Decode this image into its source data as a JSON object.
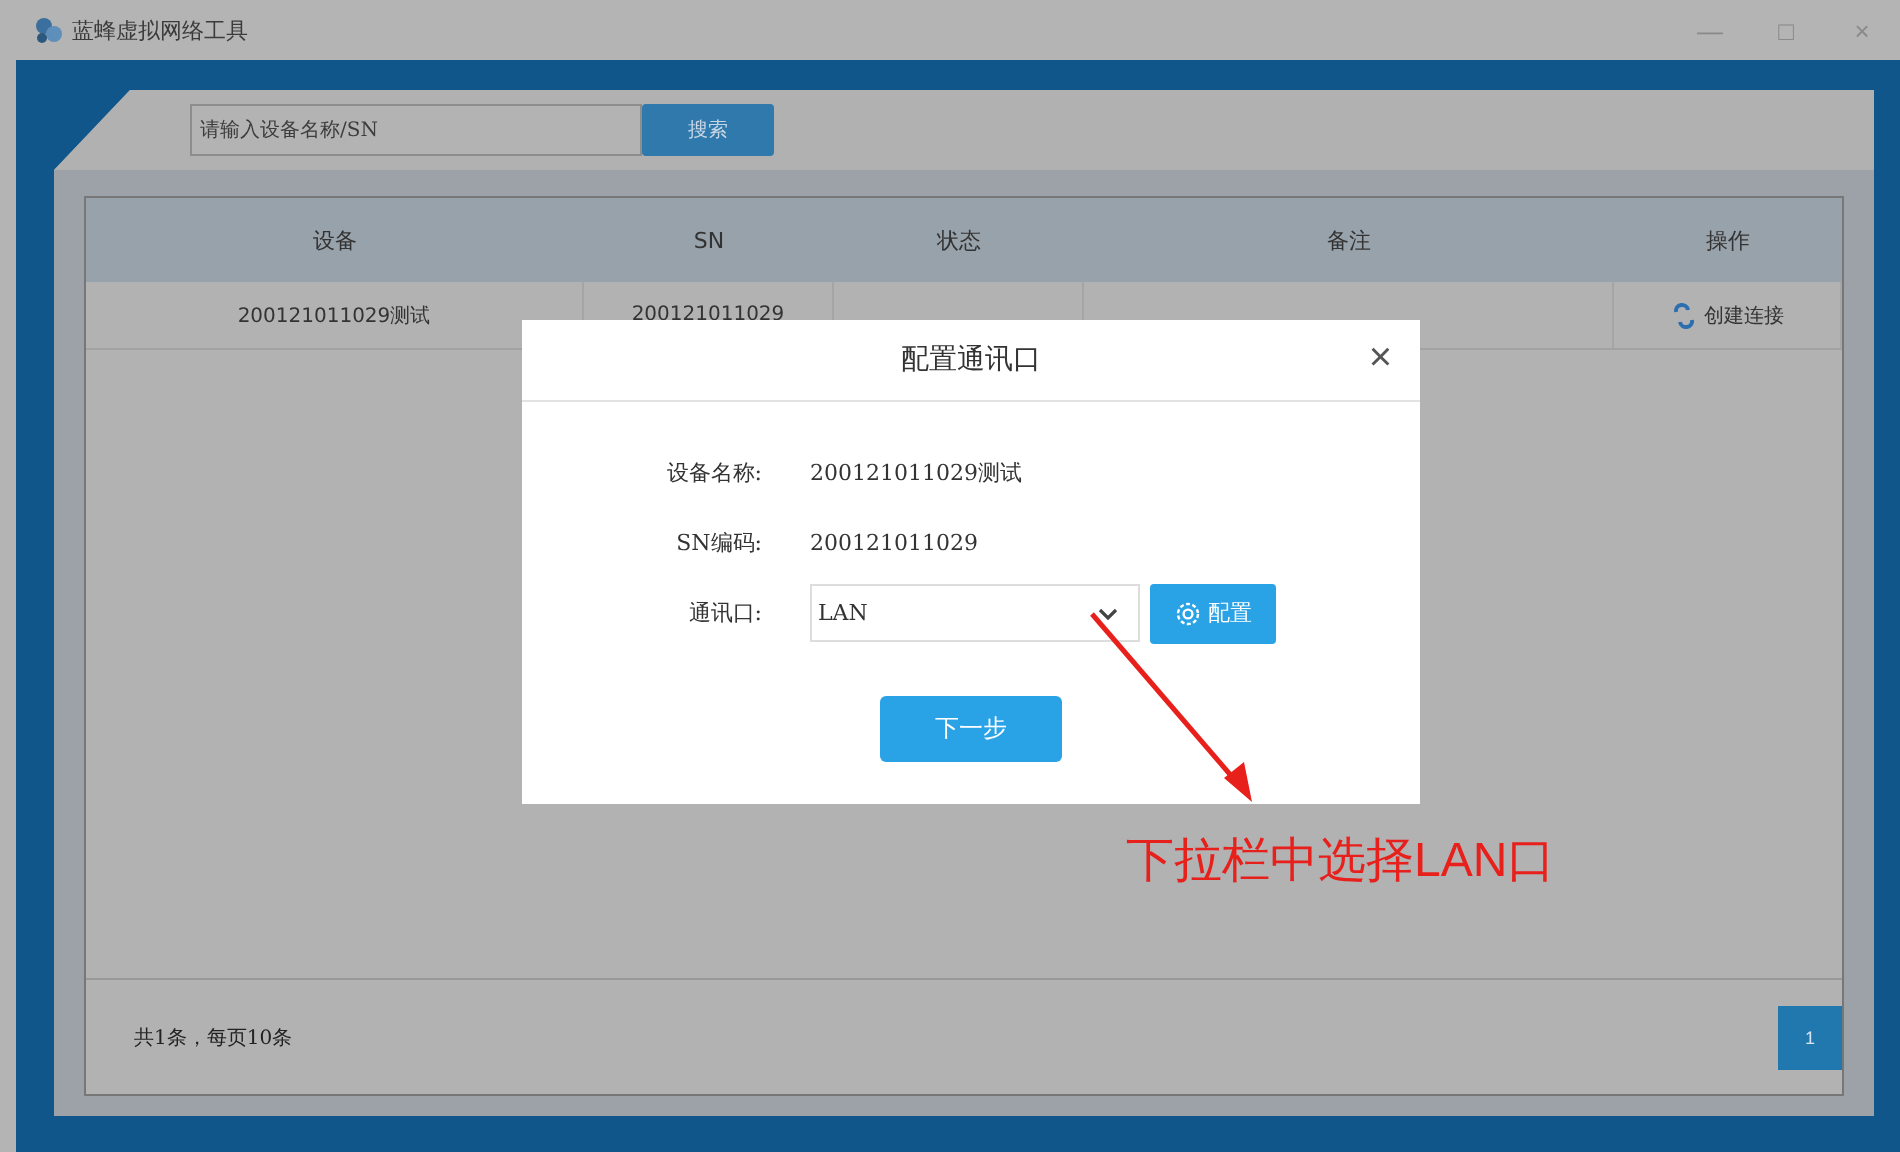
{
  "window": {
    "title": "蓝蜂虚拟网络工具",
    "controls": [
      "—",
      "□",
      "×"
    ]
  },
  "search": {
    "placeholder": "请输入设备名称/SN",
    "button": "搜索"
  },
  "table": {
    "columns": [
      "设备",
      "SN",
      "状态",
      "备注",
      "操作"
    ],
    "rows": [
      {
        "device": "200121011029测试",
        "sn": "200121011029",
        "action": "创建连接"
      }
    ]
  },
  "footer": {
    "summary": "共1条，每页10条",
    "pages": [
      {
        "label": "1",
        "selected": true
      }
    ]
  },
  "dialog": {
    "title": "配置通讯口",
    "close": "×",
    "fields": [
      {
        "kind": "text",
        "label": "设备名称:",
        "value": "200121011029测试"
      },
      {
        "kind": "text",
        "label": "SN编码:",
        "value": "200121011029"
      },
      {
        "kind": "select",
        "label": "通讯口:",
        "value": "LAN",
        "button": "配置"
      }
    ],
    "next": "下一步"
  },
  "annotation": {
    "text": "下拉栏中选择LAN口"
  }
}
